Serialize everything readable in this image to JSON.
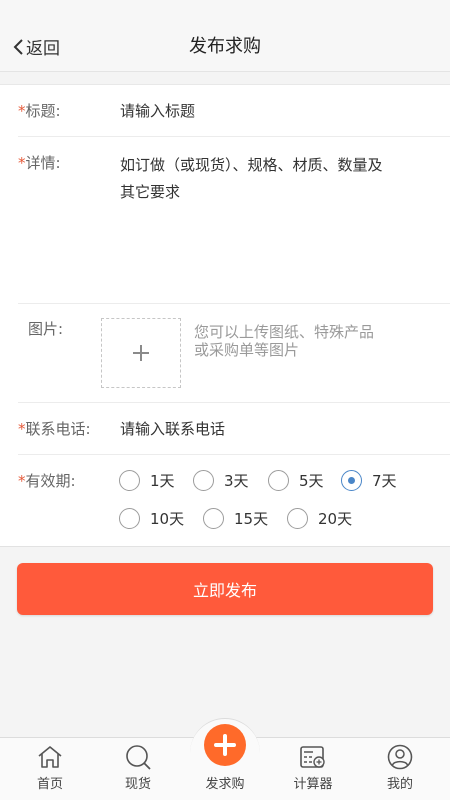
{
  "header": {
    "back_label": "返回",
    "title": "发布求购"
  },
  "form": {
    "title_field": {
      "required_mark": "*",
      "label": "标题:",
      "placeholder": "请输入标题"
    },
    "details_field": {
      "required_mark": "*",
      "label": "详情:",
      "placeholder_line1": "如订做（或现货）、规格、材质、数量及",
      "placeholder_line2": "其它要求"
    },
    "image_field": {
      "label": "图片:",
      "hint_line1": "您可以上传图纸、特殊产品",
      "hint_line2": "或采购单等图片",
      "upload_icon": "plus-icon"
    },
    "phone_field": {
      "required_mark": "*",
      "label": "联系电话:",
      "placeholder": "请输入联系电话"
    },
    "validity_field": {
      "required_mark": "*",
      "label": "有效期:",
      "options": [
        "1天",
        "3天",
        "5天",
        "7天",
        "10天",
        "15天",
        "20天"
      ],
      "selected": "7天"
    }
  },
  "publish_button": {
    "label": "立即发布",
    "color": "#ff5a3b"
  },
  "tabbar": {
    "items": [
      {
        "label": "首页",
        "icon": "home-icon"
      },
      {
        "label": "现货",
        "icon": "search-icon"
      },
      {
        "label": "发求购",
        "icon": "plus-icon"
      },
      {
        "label": "计算器",
        "icon": "calculator-icon"
      },
      {
        "label": "我的",
        "icon": "user-icon"
      }
    ],
    "accent_color": "#ff6a2a"
  }
}
